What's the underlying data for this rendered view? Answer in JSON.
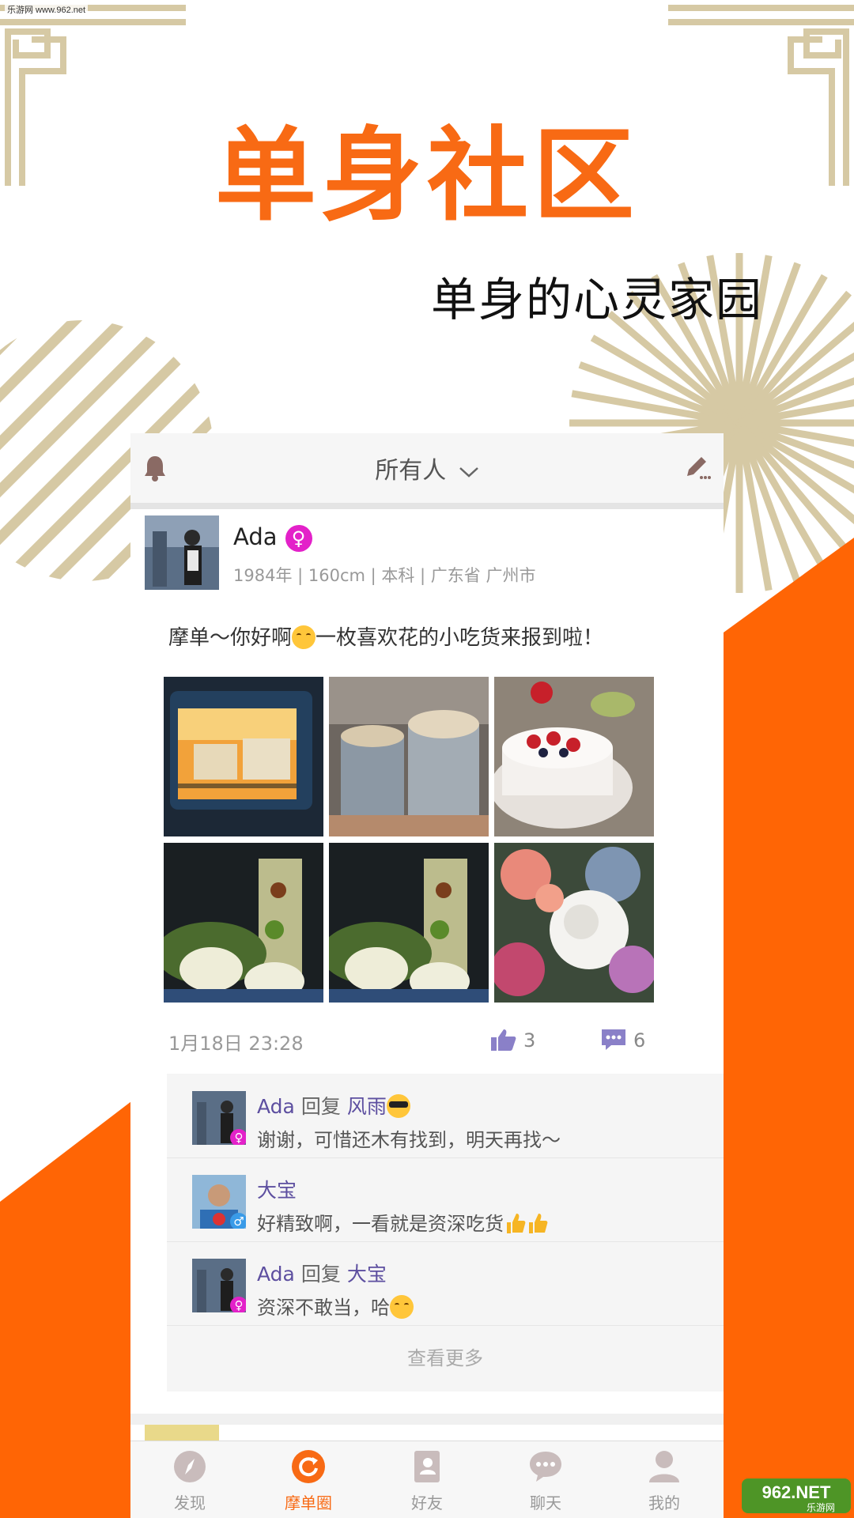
{
  "watermark": "乐游网 www.962.net",
  "hero": {
    "title": "单身社区",
    "subtitle": "单身的心灵家园"
  },
  "colors": {
    "accent": "#f86a14",
    "decor": "#d6c9a4",
    "link": "#5d4fa0",
    "female": "#e321c9",
    "male": "#3a9be8"
  },
  "topbar": {
    "filter_label": "所有人",
    "left_icon": "bell-icon",
    "right_icon": "edit-icon"
  },
  "post": {
    "author": "Ada",
    "gender_symbol": "♀",
    "meta": "1984年 | 160cm | 本科 | 广东省 广州市",
    "text_before": "摩单～你好啊",
    "text_after": "一枚喜欢花的小吃货来报到啦！",
    "time": "1月18日 23:28",
    "likes": "3",
    "comments_count": "6"
  },
  "comments": [
    {
      "name": "Ada",
      "reply_word": "回复",
      "reply_to": "风雨",
      "text": "谢谢，可惜还木有找到，明天再找～",
      "gender_symbol": "♀"
    },
    {
      "name": "大宝",
      "reply_word": "",
      "reply_to": "",
      "text": "好精致啊，一看就是资深吃货",
      "gender_symbol": "♂"
    },
    {
      "name": "Ada",
      "reply_word": "回复",
      "reply_to": "大宝",
      "text": "资深不敢当，哈",
      "gender_symbol": "♀"
    }
  ],
  "see_more": "查看更多",
  "tabs": [
    {
      "label": "发现",
      "icon": "compass-icon"
    },
    {
      "label": "摩单圈",
      "icon": "circle-refresh-icon"
    },
    {
      "label": "好友",
      "icon": "contacts-icon"
    },
    {
      "label": "聊天",
      "icon": "chat-icon"
    },
    {
      "label": "我的",
      "icon": "person-icon"
    }
  ],
  "logo": {
    "text": "962.NET",
    "subtext": "乐游网"
  }
}
